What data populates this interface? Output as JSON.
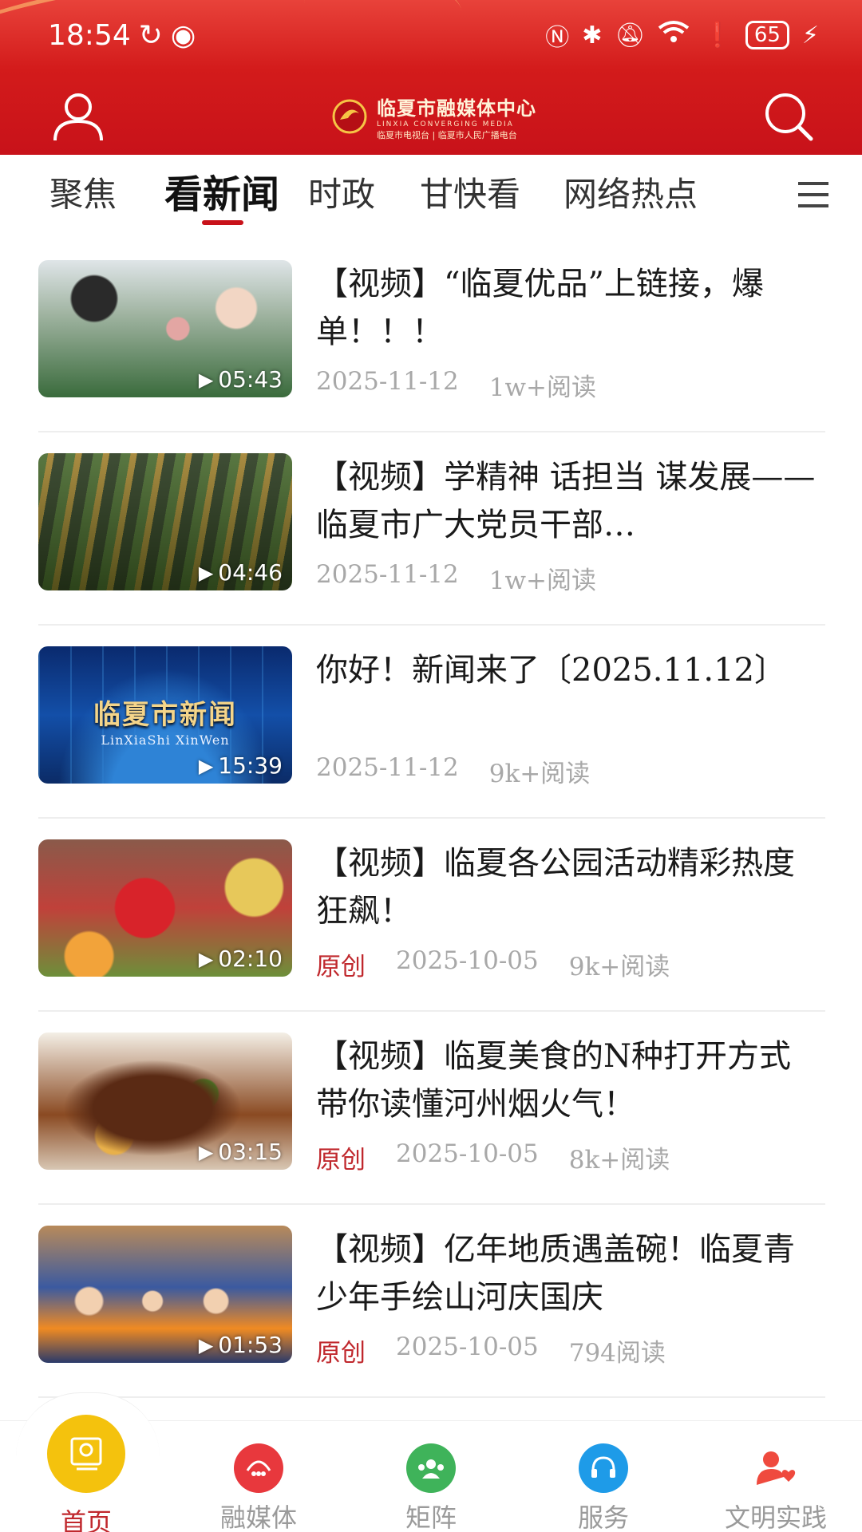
{
  "status_bar": {
    "time": "18:54",
    "battery": "65"
  },
  "header": {
    "brand_title": "临夏市融媒体中心",
    "brand_sub": "LINXIA CONVERGING MEDIA",
    "brand_sub2": "临夏市电视台 | 临夏市人民广播电台",
    "accent_color": "#c8121a"
  },
  "tabs": [
    {
      "label": "聚焦"
    },
    {
      "label": "看新闻",
      "active": true
    },
    {
      "label": "时政"
    },
    {
      "label": "甘快看"
    },
    {
      "label": "网络热点"
    }
  ],
  "news": [
    {
      "title": "【视频】“临夏优品”上链接，爆单！！！",
      "duration": "05:43",
      "date": "2025-11-12",
      "reads": "1w+阅读",
      "tag": ""
    },
    {
      "title": "【视频】学精神 话担当 谋发展——临夏市广大党员干部…",
      "duration": "04:46",
      "date": "2025-11-12",
      "reads": "1w+阅读",
      "tag": ""
    },
    {
      "title": "你好！新闻来了〔2025.11.12〕",
      "duration": "15:39",
      "date": "2025-11-12",
      "reads": "9k+阅读",
      "tag": "",
      "thumb_title": "临夏市新闻",
      "thumb_sub": "LinXiaShi XinWen"
    },
    {
      "title": "【视频】临夏各公园活动精彩热度狂飙！",
      "duration": "02:10",
      "date": "2025-10-05",
      "reads": "9k+阅读",
      "tag": "原创"
    },
    {
      "title": "【视频】临夏美食的N种打开方式　带你读懂河州烟火气！",
      "duration": "03:15",
      "date": "2025-10-05",
      "reads": "8k+阅读",
      "tag": "原创"
    },
    {
      "title": "【视频】亿年地质遇盖碗！临夏青少年手绘山河庆国庆",
      "duration": "01:53",
      "date": "2025-10-05",
      "reads": "794阅读",
      "tag": "原创"
    }
  ],
  "bottom_nav": [
    {
      "label": "首页",
      "icon": "home-icon",
      "color": "#f4c20d"
    },
    {
      "label": "融媒体",
      "icon": "media-icon",
      "color": "#e8383d"
    },
    {
      "label": "矩阵",
      "icon": "matrix-icon",
      "color": "#3fb35a"
    },
    {
      "label": "服务",
      "icon": "service-icon",
      "color": "#1e9be8"
    },
    {
      "label": "文明实践",
      "icon": "volunteer-icon",
      "color": "#ef4a3e"
    }
  ]
}
